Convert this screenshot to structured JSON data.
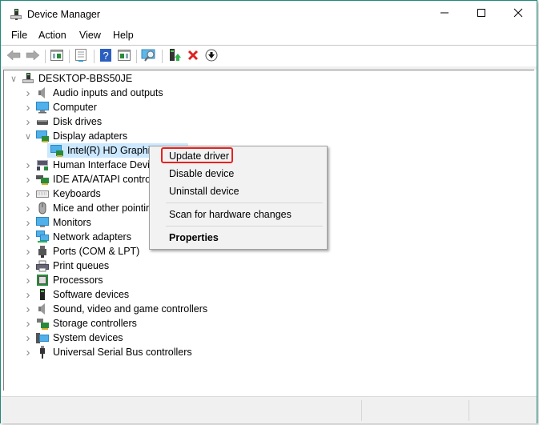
{
  "window": {
    "title": "Device Manager",
    "controls": {
      "minimize": "minimize-icon",
      "maximize": "maximize-icon",
      "close": "close-icon"
    }
  },
  "menubar": [
    "File",
    "Action",
    "View",
    "Help"
  ],
  "toolbar": [
    {
      "name": "back",
      "icon": "back-arrow-icon"
    },
    {
      "name": "forward",
      "icon": "forward-arrow-icon"
    },
    {
      "name": "show-hide-console-tree",
      "icon": "console-tree-icon"
    },
    {
      "name": "properties",
      "icon": "properties-icon"
    },
    {
      "name": "help",
      "icon": "help-icon"
    },
    {
      "name": "show-hide-action-pane",
      "icon": "action-pane-icon"
    },
    {
      "name": "scan-hardware",
      "icon": "scan-monitor-icon"
    },
    {
      "name": "update-driver",
      "icon": "update-driver-icon"
    },
    {
      "name": "uninstall-device",
      "icon": "red-x-icon"
    },
    {
      "name": "disable-device",
      "icon": "down-arrow-circle-icon"
    }
  ],
  "tree": {
    "root": "DESKTOP-BBS50JE",
    "items": [
      {
        "label": "Audio inputs and outputs",
        "icon": "speaker-icon",
        "expanded": false
      },
      {
        "label": "Computer",
        "icon": "computer-icon",
        "expanded": false
      },
      {
        "label": "Disk drives",
        "icon": "disk-drive-icon",
        "expanded": false
      },
      {
        "label": "Display adapters",
        "icon": "display-adapter-icon",
        "expanded": true,
        "children": [
          {
            "label": "Intel(R) HD Graphics",
            "icon": "display-adapter-icon",
            "selected": true
          }
        ]
      },
      {
        "label": "Human Interface Devices",
        "icon": "hid-icon",
        "expanded": false
      },
      {
        "label": "IDE ATA/ATAPI controllers",
        "icon": "ide-controller-icon",
        "expanded": false
      },
      {
        "label": "Keyboards",
        "icon": "keyboard-icon",
        "expanded": false
      },
      {
        "label": "Mice and other pointing devices",
        "icon": "mouse-icon",
        "expanded": false
      },
      {
        "label": "Monitors",
        "icon": "monitor-icon",
        "expanded": false
      },
      {
        "label": "Network adapters",
        "icon": "network-adapter-icon",
        "expanded": false
      },
      {
        "label": "Ports (COM & LPT)",
        "icon": "port-icon",
        "expanded": false
      },
      {
        "label": "Print queues",
        "icon": "printer-icon",
        "expanded": false
      },
      {
        "label": "Processors",
        "icon": "processor-icon",
        "expanded": false
      },
      {
        "label": "Software devices",
        "icon": "software-device-icon",
        "expanded": false
      },
      {
        "label": "Sound, video and game controllers",
        "icon": "speaker-icon",
        "expanded": false
      },
      {
        "label": "Storage controllers",
        "icon": "storage-controller-icon",
        "expanded": false
      },
      {
        "label": "System devices",
        "icon": "system-device-icon",
        "expanded": false
      },
      {
        "label": "Universal Serial Bus controllers",
        "icon": "usb-icon",
        "expanded": false
      }
    ]
  },
  "context_menu": {
    "items": [
      {
        "label": "Update driver",
        "highlighted": true
      },
      {
        "label": "Disable device"
      },
      {
        "label": "Uninstall device"
      },
      {
        "label": "Scan for hardware changes"
      },
      {
        "label": "Properties",
        "bold": true
      }
    ]
  },
  "colors": {
    "highlight_border": "#e42320",
    "selection": "#cce8ff",
    "window_border": "#1f8a7a"
  }
}
